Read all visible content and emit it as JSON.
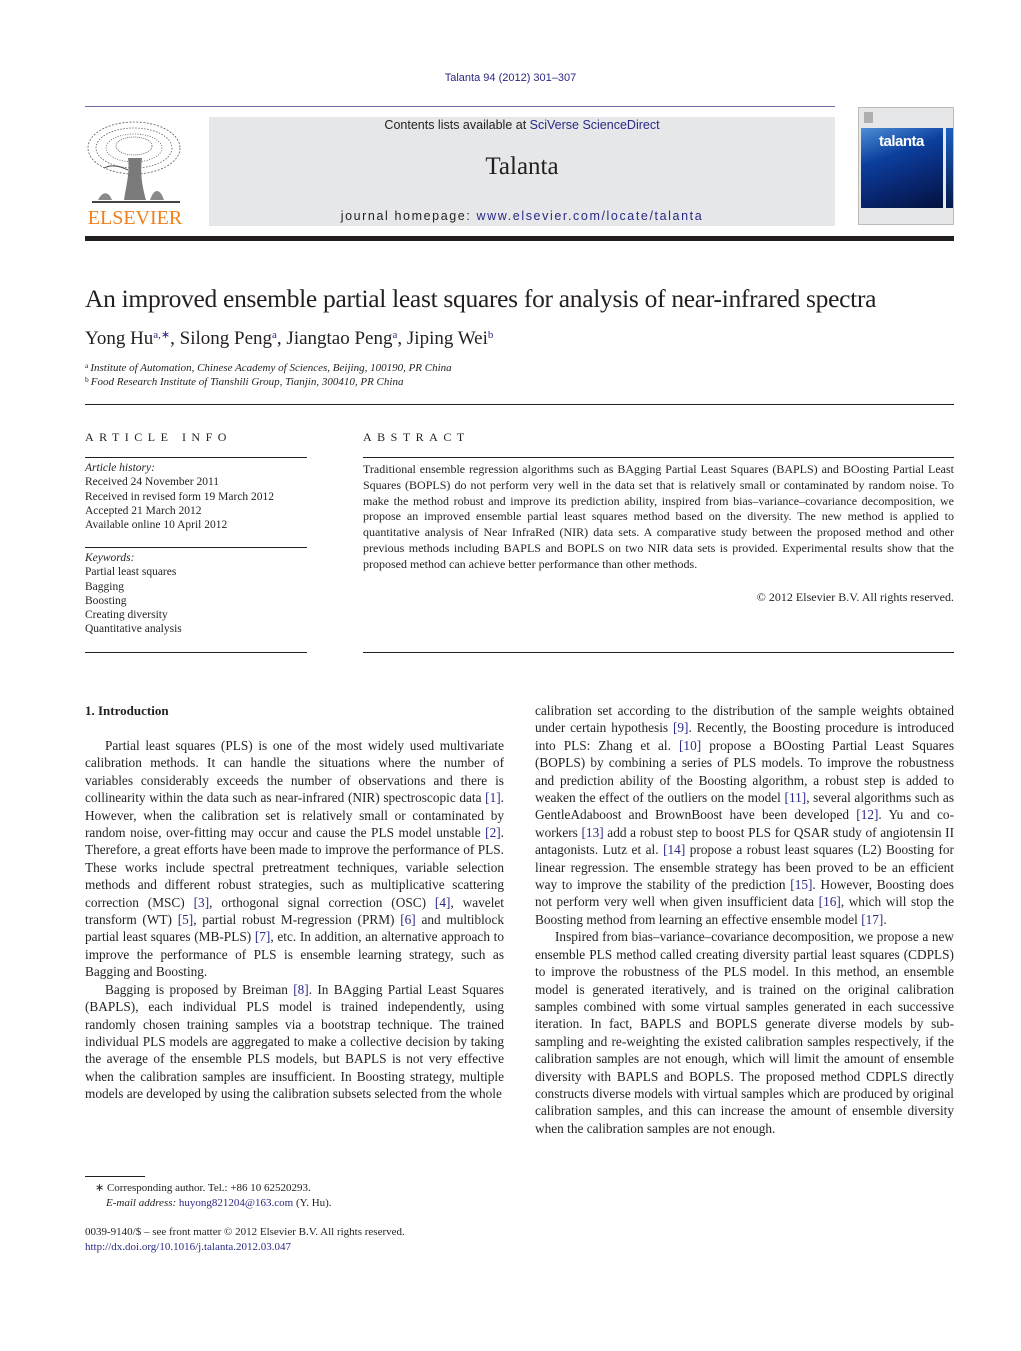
{
  "header": {
    "running_head": "Talanta 94 (2012) 301–307",
    "publisher_logo_text": "ELSEVIER",
    "contents_prefix": "Contents lists available at ",
    "contents_link": "SciVerse ScienceDirect",
    "journal_name": "Talanta",
    "homepage_prefix": "journal homepage: ",
    "homepage_url": "www.elsevier.com/locate/talanta",
    "cover_title": "talanta",
    "colors": {
      "link": "#2a2a86",
      "elsevier_orange": "#f07f1a",
      "masthead_bg": "#e6e7e8"
    }
  },
  "article": {
    "title": "An improved ensemble partial least squares for analysis of near-infrared spectra",
    "authors": [
      {
        "name": "Yong Hu",
        "sup": "a,∗"
      },
      {
        "name": "Silong Peng",
        "sup": "a"
      },
      {
        "name": "Jiangtao Peng",
        "sup": "a"
      },
      {
        "name": "Jiping Wei",
        "sup": "b"
      }
    ],
    "affiliations": [
      {
        "mark": "a",
        "text": "Institute of Automation, Chinese Academy of Sciences, Beijing, 100190, PR China"
      },
      {
        "mark": "b",
        "text": "Food Research Institute of Tianshili Group, Tianjin, 300410, PR China"
      }
    ]
  },
  "article_info": {
    "heading": "ARTICLE INFO",
    "history_label": "Article history:",
    "history": [
      "Received 24 November 2011",
      "Received in revised form 19 March 2012",
      "Accepted 21 March 2012",
      "Available online 10 April 2012"
    ],
    "keywords_label": "Keywords:",
    "keywords": [
      "Partial least squares",
      "Bagging",
      "Boosting",
      "Creating diversity",
      "Quantitative analysis"
    ]
  },
  "abstract": {
    "heading": "ABSTRACT",
    "text": "Traditional ensemble regression algorithms such as BAgging Partial Least Squares (BAPLS) and BOosting Partial Least Squares (BOPLS) do not perform very well in the data set that is relatively small or contaminated by random noise. To make the method robust and improve its prediction ability, inspired from bias–variance–covariance decomposition, we propose an improved ensemble partial least squares method based on the diversity. The new method is applied to quantitative analysis of Near InfraRed (NIR) data sets. A comparative study between the proposed method and other previous methods including BAPLS and BOPLS on two NIR data sets is provided. Experimental results show that the proposed method can achieve better performance than other methods.",
    "copyright": "© 2012 Elsevier B.V. All rights reserved."
  },
  "introduction": {
    "heading": "1.  Introduction",
    "left_column": [
      [
        {
          "t": "Partial least squares (PLS) is one of the most widely used multivariate calibration methods. It can handle the situations where the number of variables considerably exceeds the number of observations and there is collinearity within the data such as near-infrared (NIR) spectroscopic data "
        },
        {
          "ref": "[1]"
        },
        {
          "t": ". However, when the calibration set is relatively small or contaminated by random noise, over-fitting may occur and cause the PLS model unstable "
        },
        {
          "ref": "[2]"
        },
        {
          "t": ". Therefore, a great efforts have been made to improve the performance of PLS. These works include spectral pretreatment techniques, variable selection methods and different robust strategies, such as multiplicative scattering correction (MSC) "
        },
        {
          "ref": "[3]"
        },
        {
          "t": ", orthogonal signal correction (OSC) "
        },
        {
          "ref": "[4]"
        },
        {
          "t": ", wavelet transform (WT) "
        },
        {
          "ref": "[5]"
        },
        {
          "t": ", partial robust M-regression (PRM) "
        },
        {
          "ref": "[6]"
        },
        {
          "t": " and multiblock partial least squares (MB-PLS) "
        },
        {
          "ref": "[7]"
        },
        {
          "t": ", etc. In addition, an alternative approach to improve the performance of PLS is ensemble learning strategy, such as Bagging and Boosting."
        }
      ],
      [
        {
          "t": "Bagging is proposed by Breiman "
        },
        {
          "ref": "[8]"
        },
        {
          "t": ". In BAgging Partial Least Squares (BAPLS), each individual PLS model is trained independently, using randomly chosen training samples via a bootstrap technique. The trained individual PLS models are aggregated to make a collective decision by taking the average of the ensemble PLS models, but BAPLS is not very effective when the calibration samples are insufficient. In Boosting strategy, multiple models are developed by using the calibration subsets selected from the whole"
        }
      ]
    ],
    "right_column": [
      [
        {
          "t": "calibration set according to the distribution of the sample weights obtained under certain hypothesis "
        },
        {
          "ref": "[9]"
        },
        {
          "t": ". Recently, the Boosting procedure is introduced into PLS: Zhang et al. "
        },
        {
          "ref": "[10]"
        },
        {
          "t": " propose a BOosting Partial Least Squares (BOPLS) by combining a series of PLS models. To improve the robustness and prediction ability of the Boosting algorithm, a robust step is added to weaken the effect of the outliers on the model "
        },
        {
          "ref": "[11]"
        },
        {
          "t": ", several algorithms such as GentleAdaboost and BrownBoost have been developed "
        },
        {
          "ref": "[12]"
        },
        {
          "t": ". Yu and co-workers "
        },
        {
          "ref": "[13]"
        },
        {
          "t": " add a robust step to boost PLS for QSAR study of angiotensin II antagonists. Lutz et al. "
        },
        {
          "ref": "[14]"
        },
        {
          "t": " propose a robust least squares (L2) Boosting for linear regression. The ensemble strategy has been proved to be an efficient way to improve the stability of the prediction "
        },
        {
          "ref": "[15]"
        },
        {
          "t": ". However, Boosting does not perform very well when given insufficient data "
        },
        {
          "ref": "[16]"
        },
        {
          "t": ", which will stop the Boosting method from learning an effective ensemble model "
        },
        {
          "ref": "[17]"
        },
        {
          "t": "."
        }
      ],
      [
        {
          "t": "Inspired from bias–variance–covariance decomposition, we propose a new ensemble PLS method called creating diversity partial least squares (CDPLS) to improve the robustness of the PLS model. In this method, an ensemble model is generated iteratively, and is trained on the original calibration samples combined with some virtual samples generated in each successive iteration. In fact, BAPLS and BOPLS generate diverse models by sub-sampling and re-weighting the existed calibration samples respectively, if the calibration samples are not enough, which will limit the amount of ensemble diversity with BAPLS and BOPLS. The proposed method CDPLS directly constructs diverse models with virtual samples which are produced by original calibration samples, and this can increase the amount of ensemble diversity when the calibration samples are not enough."
        }
      ]
    ]
  },
  "footnotes": {
    "corresponding": "∗  Corresponding author. Tel.: +86 10 62520293.",
    "email_label": "E-mail address: ",
    "email": "huyong821204@163.com",
    "email_suffix": " (Y. Hu).",
    "issn_line": "0039-9140/$ – see front matter © 2012 Elsevier B.V. All rights reserved.",
    "doi": "http://dx.doi.org/10.1016/j.talanta.2012.03.047"
  }
}
